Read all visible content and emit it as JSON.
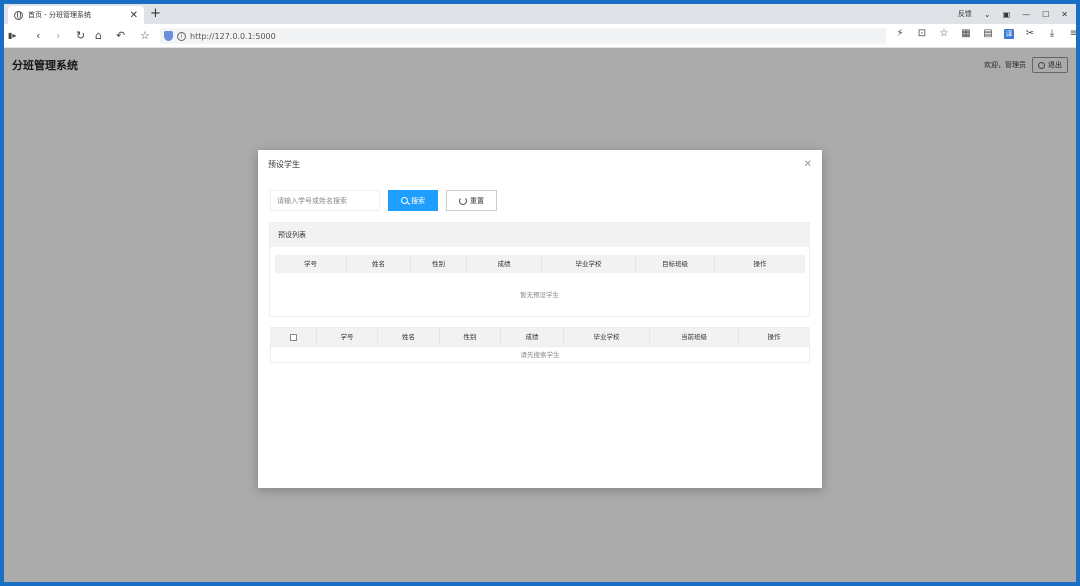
{
  "browser": {
    "tab_title": "首页 - 分班管理系统",
    "feedback": "反馈",
    "url": "http://127.0.0.1:5000"
  },
  "app": {
    "title": "分班管理系统",
    "welcome": "欢迎，管理员",
    "logout": "退出"
  },
  "modal": {
    "title": "预设学生",
    "search_placeholder": "请输入学号或姓名搜索",
    "search_button": "搜索",
    "reset_button": "重置",
    "preset_list_title": "预设列表",
    "preset_columns": [
      "学号",
      "姓名",
      "性别",
      "成绩",
      "毕业学校",
      "目标班级",
      "操作"
    ],
    "preset_empty": "暂无预设学生",
    "search_columns": [
      "学号",
      "姓名",
      "性别",
      "成绩",
      "毕业学校",
      "当前班级",
      "操作"
    ],
    "search_empty": "请先搜索学生"
  }
}
